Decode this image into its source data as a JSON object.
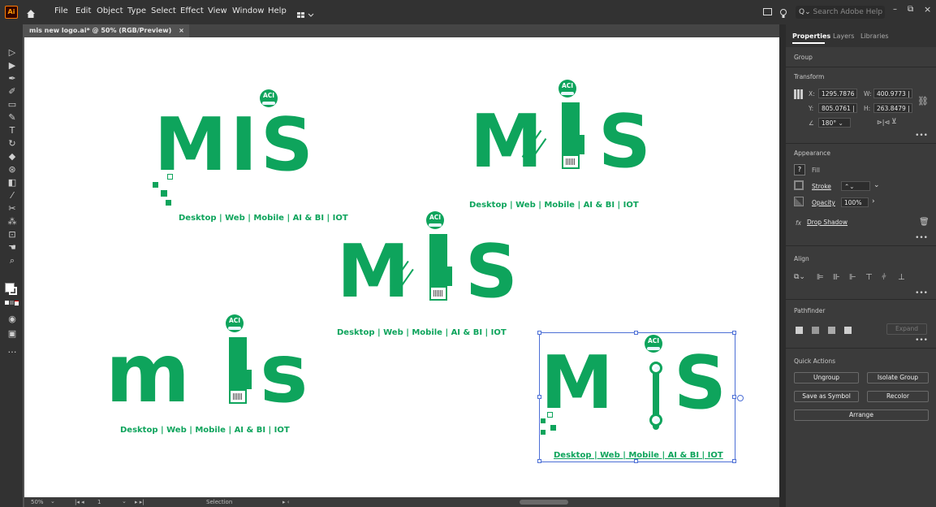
{
  "app": {
    "logo_text": "Ai"
  },
  "menu": [
    "File",
    "Edit",
    "Object",
    "Type",
    "Select",
    "Effect",
    "View",
    "Window",
    "Help"
  ],
  "search": {
    "placeholder": "Search Adobe Help"
  },
  "document": {
    "tab_title": "mis new logo.ai* @ 50% (RGB/Preview)",
    "close_glyph": "×"
  },
  "status": {
    "zoom": "50%",
    "artboard": "1",
    "tool": "Selection"
  },
  "panel": {
    "tabs": [
      "Properties",
      "Layers",
      "Libraries"
    ],
    "selection_type": "Group",
    "transform": {
      "title": "Transform",
      "x_label": "X:",
      "x": "1295.7876",
      "y_label": "Y:",
      "y": "805.0761 |",
      "w_label": "W:",
      "w": "400.9773 |",
      "h_label": "H:",
      "h": "263.8479 |",
      "angle": "180°"
    },
    "appearance": {
      "title": "Appearance",
      "fill": "Fill",
      "fill_value": "?",
      "stroke": "Stroke",
      "opacity_label": "Opacity",
      "opacity": "100%",
      "effect": "Drop Shadow"
    },
    "align_title": "Align",
    "pathfinder": {
      "title": "Pathfinder",
      "expand": "Expand"
    },
    "quick_actions": {
      "title": "Quick Actions",
      "ungroup": "Ungroup",
      "isolate": "Isolate Group",
      "save_symbol": "Save as Symbol",
      "recolor": "Recolor",
      "arrange": "Arrange"
    }
  },
  "logos": [
    {
      "letters": "MIS",
      "badge": "ACI",
      "tagline": "Desktop | Web | Mobile | AI & BI | IOT"
    },
    {
      "letters_left": "M",
      "letters_right": "S",
      "badge": "ACI",
      "tagline": "Desktop | Web | Mobile | AI & BI | IOT"
    },
    {
      "letters_left": "M",
      "letters_right": "S",
      "badge": "ACI",
      "tagline": "Desktop | Web | Mobile | AI & BI | IOT"
    },
    {
      "letters_left": "m",
      "letters_right": "s",
      "badge": "ACI",
      "tagline": "Desktop | Web | Mobile | AI & BI | IOT"
    },
    {
      "letters_left": "M",
      "letters_right": "S",
      "badge": "ACI",
      "tagline": "Desktop | Web | Mobile | AI & BI | IOT"
    }
  ],
  "colors": {
    "brand_green": "#0ea45c",
    "selection_blue": "#4c6fd6",
    "panel_bg": "#3b3b3b"
  }
}
